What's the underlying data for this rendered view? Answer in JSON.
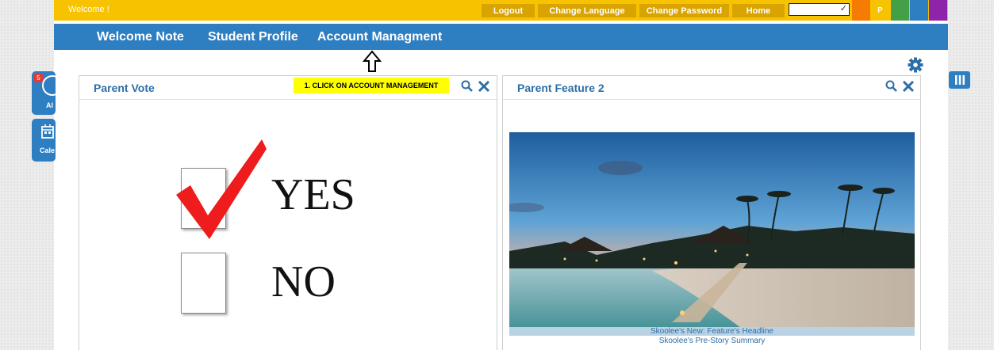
{
  "topbar": {
    "welcome": "Welcome !",
    "buttons": [
      "Logout",
      "Change Language",
      "Change Password",
      "Home"
    ],
    "theme_letter": "P",
    "colors": {
      "bar": "#f7c200",
      "button": "#d9a300"
    },
    "swatches": [
      "#f57c00",
      "#f7c200",
      "#43a047",
      "#2e7ec2",
      "#8e24aa"
    ]
  },
  "nav": {
    "items": [
      "Welcome Note",
      "Student Profile",
      "Account Managment"
    ],
    "color": "#2e7ec2"
  },
  "left_widgets": [
    {
      "label": "Al",
      "badge": "5",
      "icon": "alert-icon"
    },
    {
      "label": "Cale",
      "icon": "calendar-icon"
    }
  ],
  "cards": {
    "vote": {
      "title": "Parent Vote",
      "instruction": "1. CLICK ON ACCOUNT MANAGEMENT",
      "options": [
        "YES",
        "NO"
      ]
    },
    "feature": {
      "title": "Parent Feature 2",
      "headline": "Skoolee's New: Feature's Headline",
      "summary": "Skoolee's Pre-Story Summary"
    }
  },
  "icons": [
    "search-icon",
    "close-icon",
    "gear-icon",
    "columns-icon",
    "arrow-up-icon",
    "checkmark-icon"
  ]
}
